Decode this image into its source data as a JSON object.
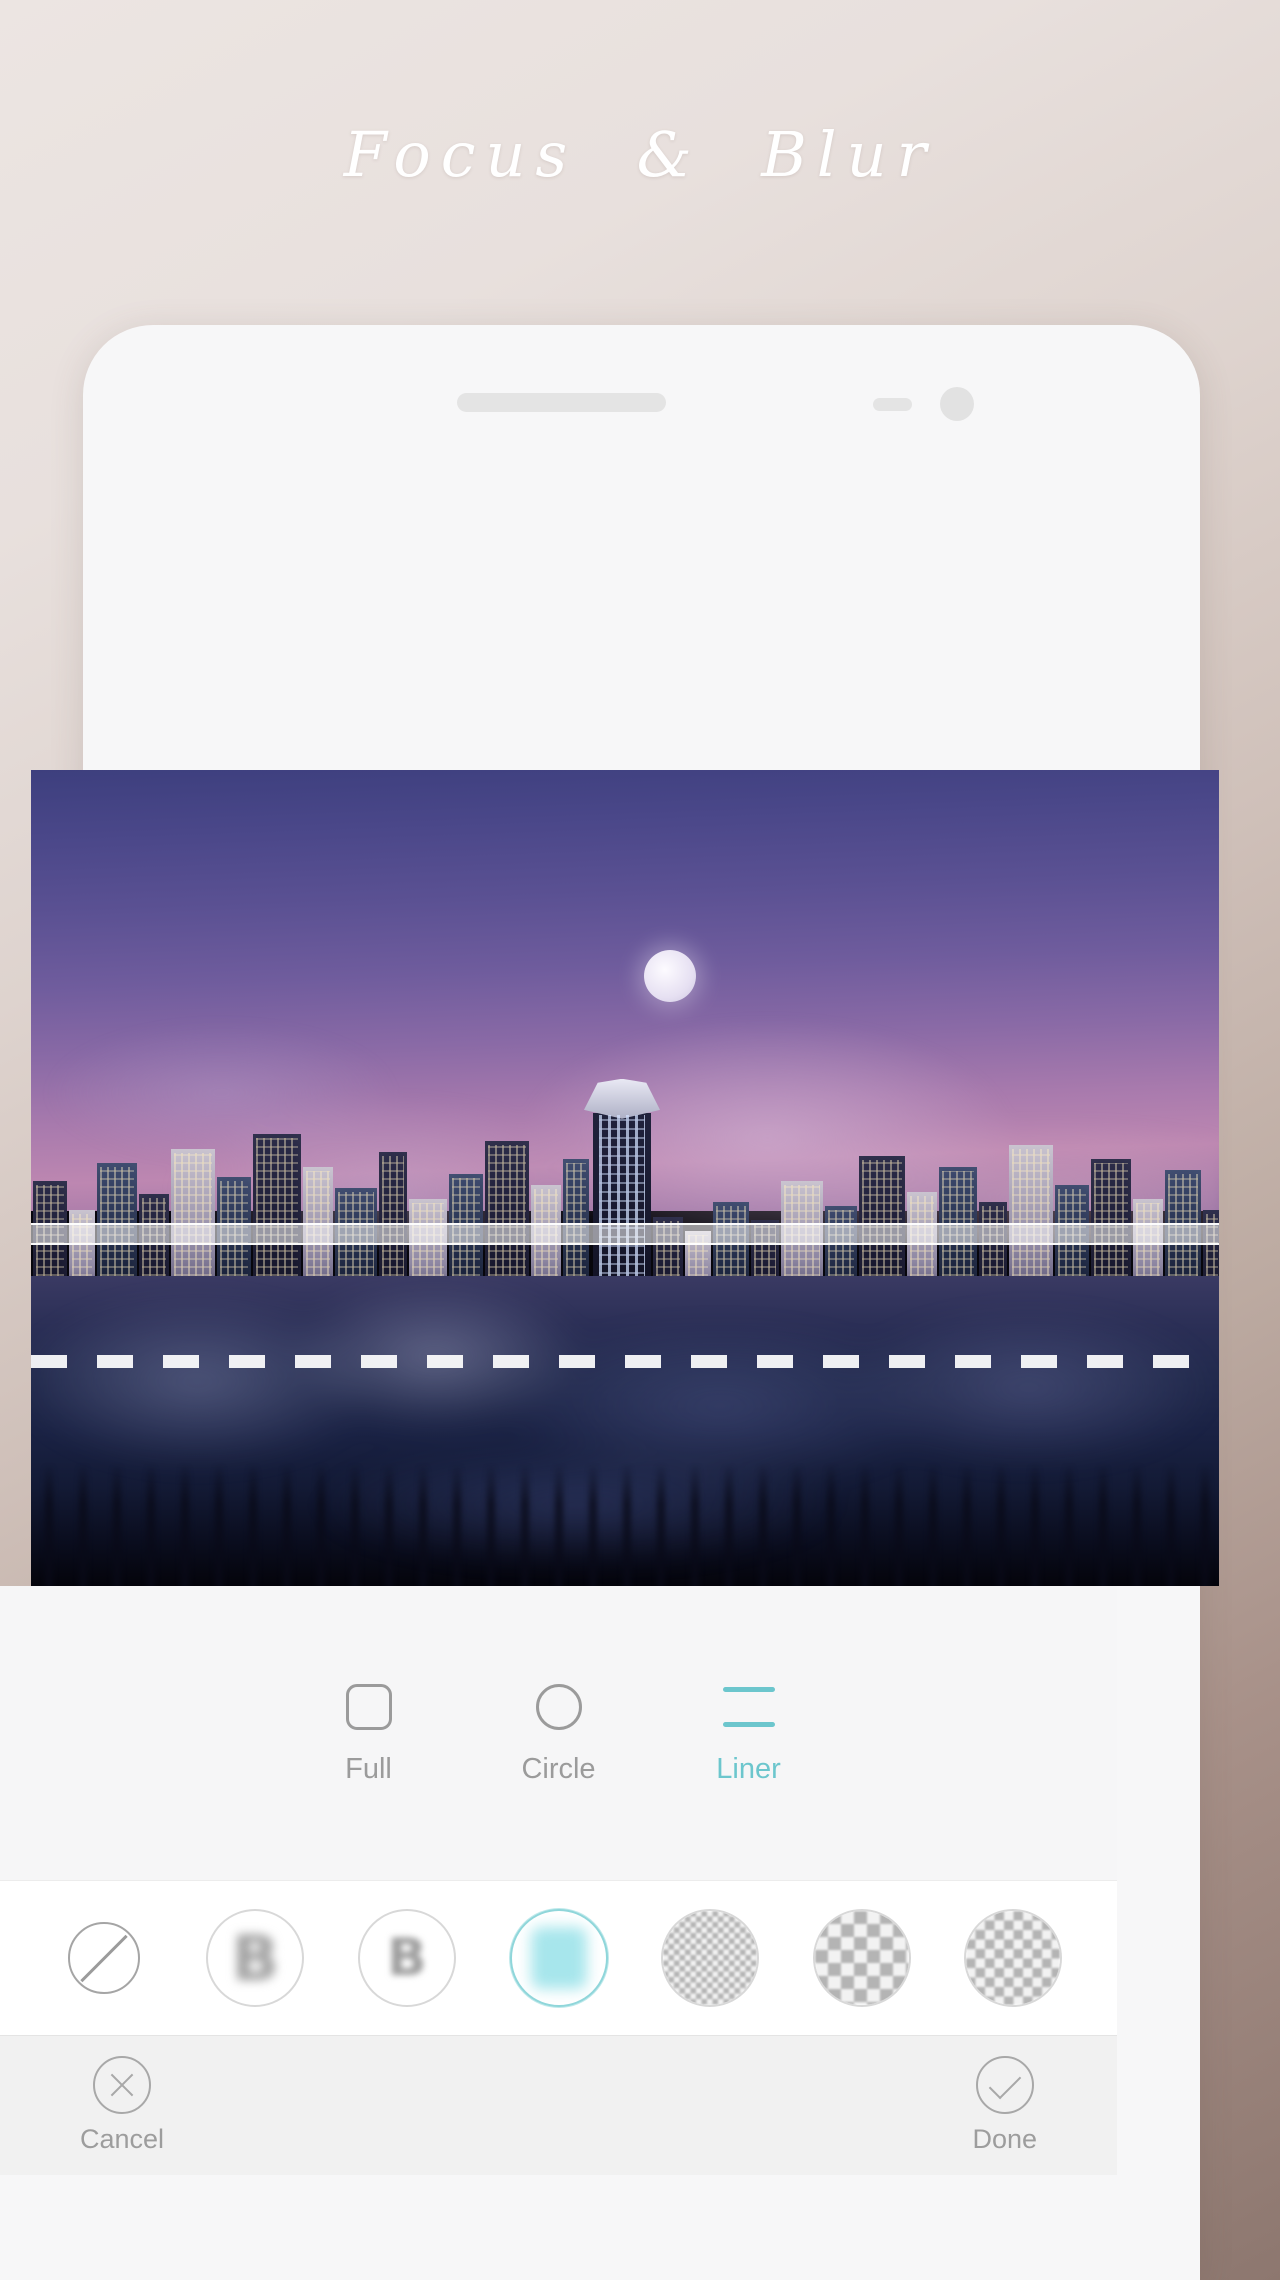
{
  "page": {
    "title": "Focus  &  Blur",
    "background_top_color": "#ece5e2",
    "background_bottom_color": "#8d776f"
  },
  "phone": {
    "speaker_icon": "speaker-grille",
    "sensor_icon": "proximity-sensor",
    "camera_icon": "front-camera"
  },
  "canvas": {
    "photo_description": "city-skyline-at-dusk",
    "moon_icon": "moon",
    "guide_solid_label": "focus-band",
    "guide_dashed_label": "falloff-line"
  },
  "modes": {
    "active": "Liner",
    "items": [
      {
        "label": "Full",
        "icon": "rounded-square-icon"
      },
      {
        "label": "Circle",
        "icon": "circle-icon"
      },
      {
        "label": "Liner",
        "icon": "two-lines-icon"
      }
    ],
    "accent_color": "#6cc6cd",
    "inactive_color": "#9b9b9b"
  },
  "brushes": {
    "selected_index": 3,
    "items": [
      {
        "name": "none",
        "icon": "no-effect-icon"
      },
      {
        "name": "blur-strong",
        "icon": "blur-b-large-icon",
        "glyph": "B"
      },
      {
        "name": "blur-soft",
        "icon": "blur-b-small-icon",
        "glyph": "B"
      },
      {
        "name": "blur-teal",
        "icon": "blur-selected-icon"
      },
      {
        "name": "mosaic-fine",
        "icon": "mosaic-fine-icon"
      },
      {
        "name": "mosaic-coarse",
        "icon": "mosaic-coarse-icon"
      },
      {
        "name": "mosaic-medium",
        "icon": "mosaic-medium-icon"
      }
    ]
  },
  "actions": {
    "cancel": {
      "label": "Cancel",
      "icon": "close-circle-icon"
    },
    "done": {
      "label": "Done",
      "icon": "check-circle-icon"
    }
  }
}
